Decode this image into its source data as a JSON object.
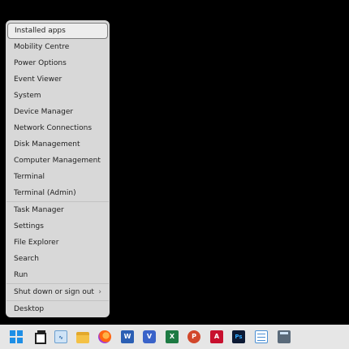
{
  "menu": {
    "items": [
      {
        "label": "Installed apps",
        "highlighted": true
      },
      {
        "label": "Mobility Centre"
      },
      {
        "label": "Power Options"
      },
      {
        "label": "Event Viewer"
      },
      {
        "label": "System"
      },
      {
        "label": "Device Manager"
      },
      {
        "label": "Network Connections"
      },
      {
        "label": "Disk Management"
      },
      {
        "label": "Computer Management"
      },
      {
        "label": "Terminal"
      },
      {
        "label": "Terminal (Admin)"
      },
      {
        "label": "Task Manager"
      },
      {
        "label": "Settings"
      },
      {
        "label": "File Explorer"
      },
      {
        "label": "Search"
      },
      {
        "label": "Run"
      },
      {
        "label": "Shut down or sign out",
        "submenu": true
      },
      {
        "label": "Desktop"
      }
    ],
    "chevron": "›"
  },
  "taskbar": {
    "icons": [
      "windows-start-icon",
      "task-view-icon",
      "performance-monitor-icon",
      "file-explorer-icon",
      "firefox-icon",
      "word-icon",
      "visio-icon",
      "excel-icon",
      "powerpoint-icon",
      "acrobat-icon",
      "photoshop-icon",
      "notepad-icon",
      "calculator-icon"
    ],
    "word_glyph": "W",
    "visio_glyph": "V",
    "excel_glyph": "X",
    "ppt_glyph": "P",
    "acrobat_glyph": "A",
    "ps_glyph": "Ps"
  },
  "colors": {
    "menu_bg": "#d8d8d8",
    "taskbar_bg": "#e6e6e6",
    "accent": "#1e8fe6"
  }
}
